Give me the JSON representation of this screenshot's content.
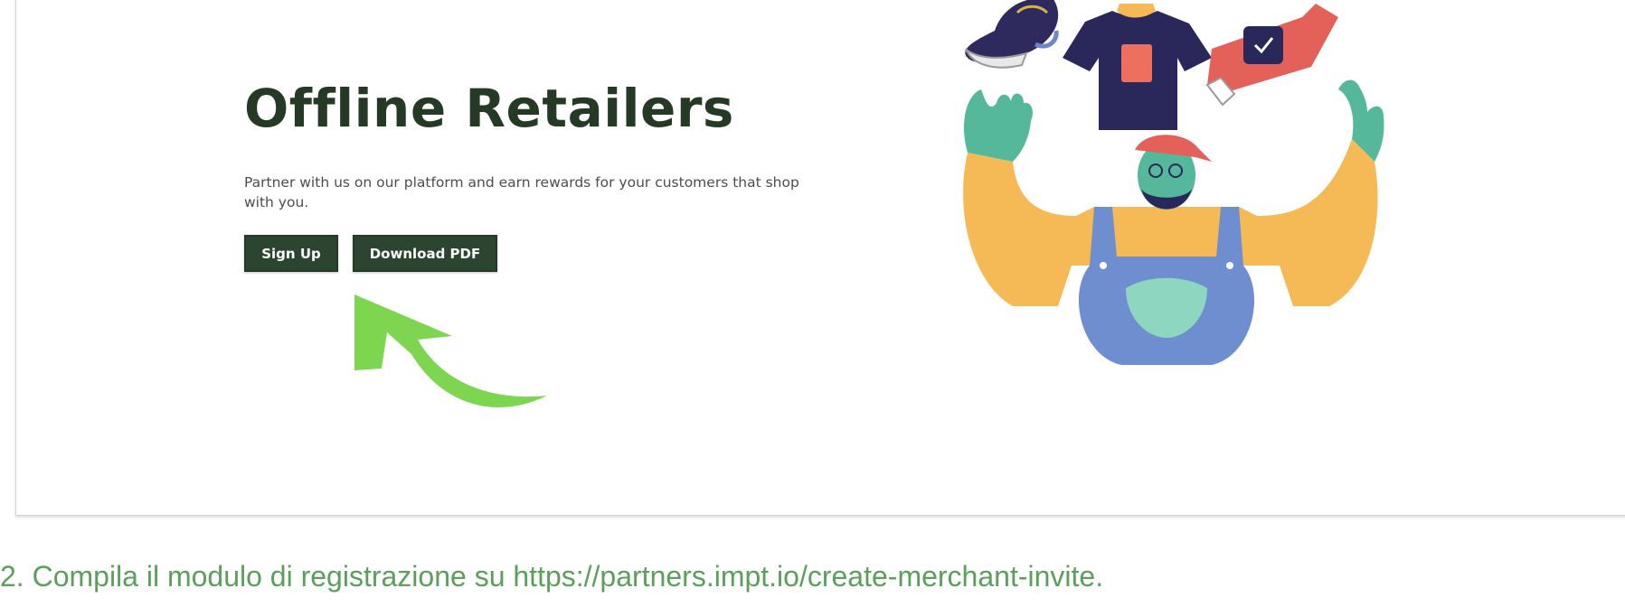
{
  "hero": {
    "title": "Offline Retailers",
    "description": "Partner with us on our platform and earn rewards for your customers that shop with you.",
    "buttons": {
      "sign_up": "Sign Up",
      "download_pdf": "Download PDF"
    }
  },
  "annotation": {
    "arrow_color": "#7ed650"
  },
  "caption": {
    "text": "2. Compila il modulo di registrazione su https://partners.impt.io/create-merchant-invite."
  },
  "colors": {
    "title": "#243a25",
    "button_bg": "#2b4530",
    "caption": "#5aa05a"
  }
}
